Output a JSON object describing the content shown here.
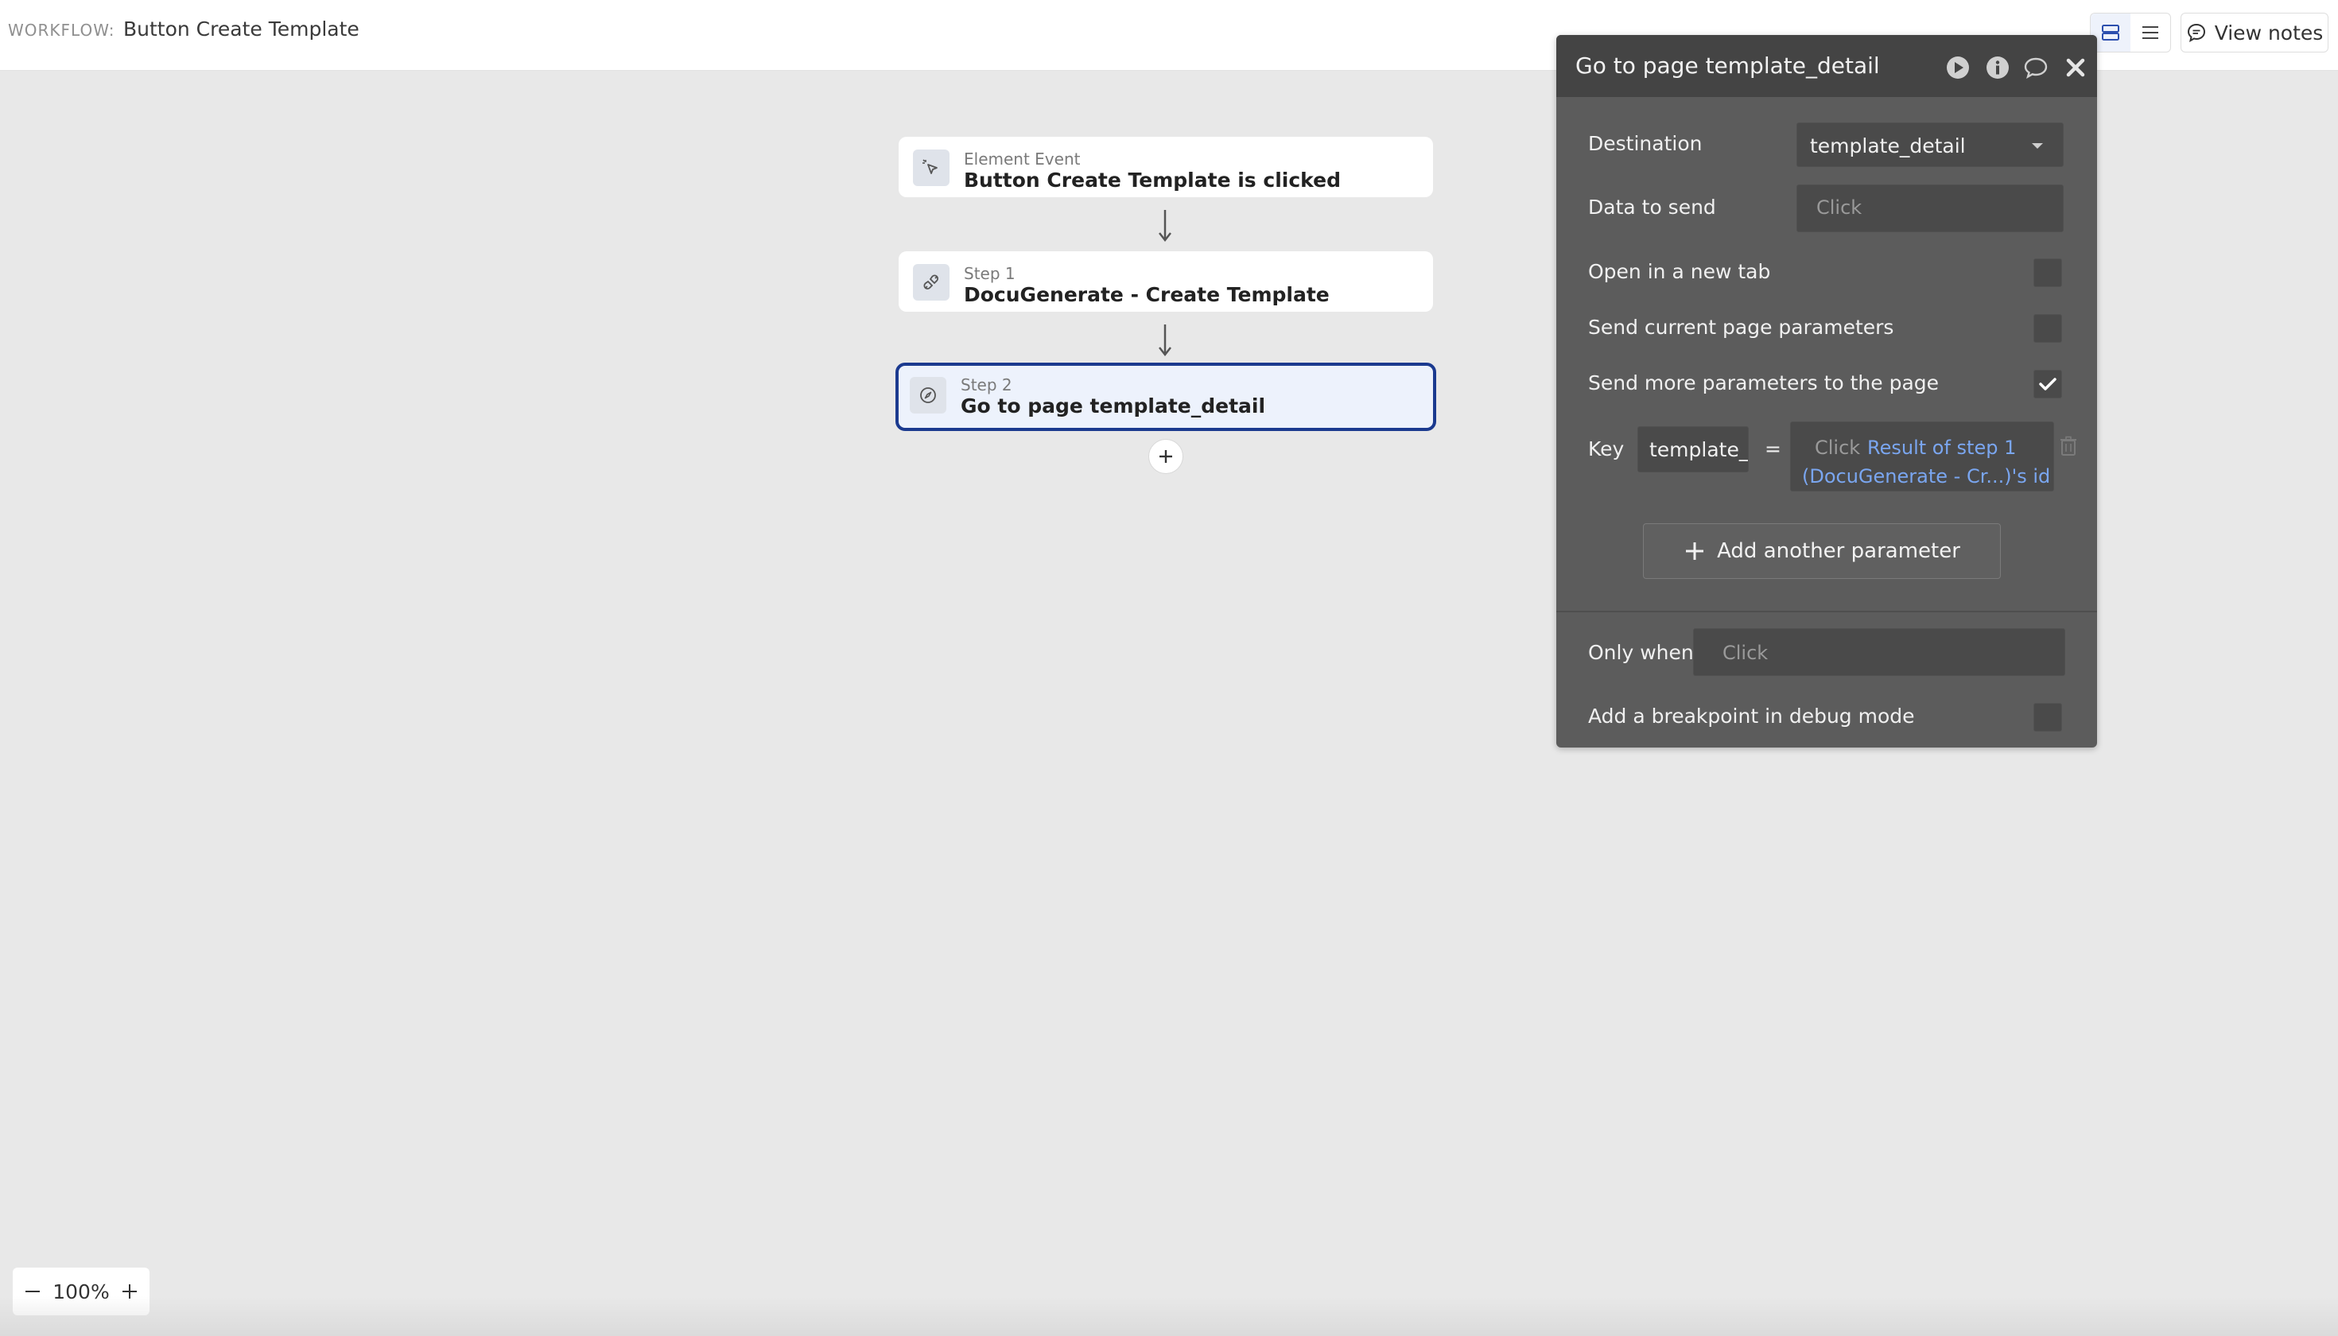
{
  "topbar": {
    "workflow_label": "WORKFLOW:",
    "workflow_name": "Button Create Template",
    "view_notes_label": "View notes"
  },
  "workflow": {
    "event": {
      "sub": "Element Event",
      "title": "Button Create Template is clicked"
    },
    "step1": {
      "sub": "Step 1",
      "title": "DocuGenerate - Create Template"
    },
    "step2": {
      "sub": "Step 2",
      "title": "Go to page template_detail"
    }
  },
  "panel": {
    "title": "Go to page template_detail",
    "destination_label": "Destination",
    "destination_value": "template_detail",
    "data_to_send_label": "Data to send",
    "data_to_send_placeholder": "Click",
    "open_new_tab_label": "Open in a new tab",
    "send_current_params_label": "Send current page parameters",
    "send_more_params_label": "Send more parameters to the page",
    "send_more_params_checked": true,
    "key_label": "Key",
    "key_value": "template_ic",
    "equals": "=",
    "value_placeholder": "Click",
    "value_dynamic_line1": "Result of step 1",
    "value_dynamic_line2": "(DocuGenerate - Cr...)'s id",
    "add_param_label": "Add another parameter",
    "only_when_label": "Only when",
    "only_when_placeholder": "Click",
    "breakpoint_label": "Add a breakpoint in debug mode"
  },
  "zoom": {
    "level": "100%"
  },
  "colors": {
    "accent": "#1b3a8f",
    "dynamic_text": "#7aa6f0",
    "panel_bg": "#5c5c5c",
    "panel_head": "#444444"
  }
}
